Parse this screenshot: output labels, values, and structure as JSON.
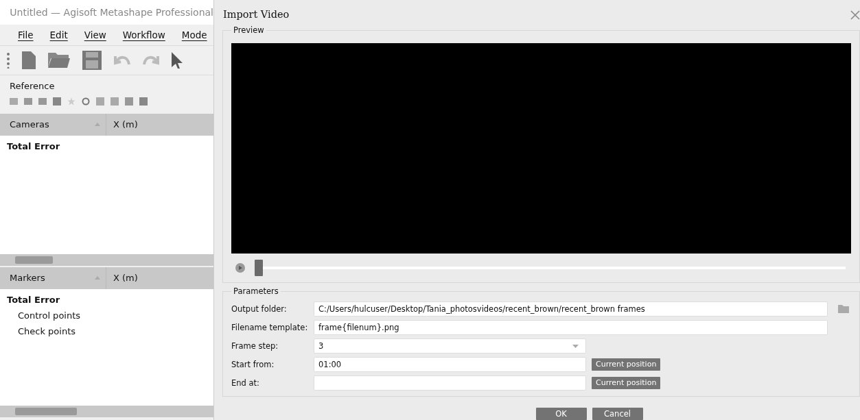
{
  "app": {
    "title": "Untitled — Agisoft Metashape Professional",
    "menu": [
      "File",
      "Edit",
      "View",
      "Workflow",
      "Mode"
    ],
    "panel_title": "Reference",
    "cameras_table": {
      "columns": [
        "Cameras",
        "X (m)"
      ],
      "rows": [
        {
          "label": "Total Error",
          "bold": true
        }
      ]
    },
    "markers_table": {
      "columns": [
        "Markers",
        "X (m)"
      ],
      "rows": [
        {
          "label": "Total Error",
          "bold": true,
          "children": [
            {
              "label": "Control points",
              "bold": false
            },
            {
              "label": "Check points",
              "bold": false
            }
          ]
        }
      ]
    }
  },
  "dialog": {
    "title": "Import Video",
    "preview": {
      "title": "Preview",
      "slider": {
        "level": 0
      }
    },
    "parameters": {
      "title": "Parameters",
      "fields": [
        {
          "label": "Output folder:",
          "kind": "folder",
          "value": "C:/Users/hulcuser/Desktop/Tania_photosvideos/recent_brown/recent_brown frames"
        },
        {
          "label": "Filename template:",
          "kind": "text",
          "value": "frame{filenum}.png"
        },
        {
          "label": "Frame step:",
          "kind": "select",
          "value": "3"
        },
        {
          "label": "Start from:",
          "kind": "position",
          "value": "01:00",
          "button": "Current position"
        },
        {
          "label": "End at:",
          "kind": "position",
          "button": "Current position"
        }
      ]
    },
    "buttons": [
      "OK",
      "Cancel"
    ]
  }
}
